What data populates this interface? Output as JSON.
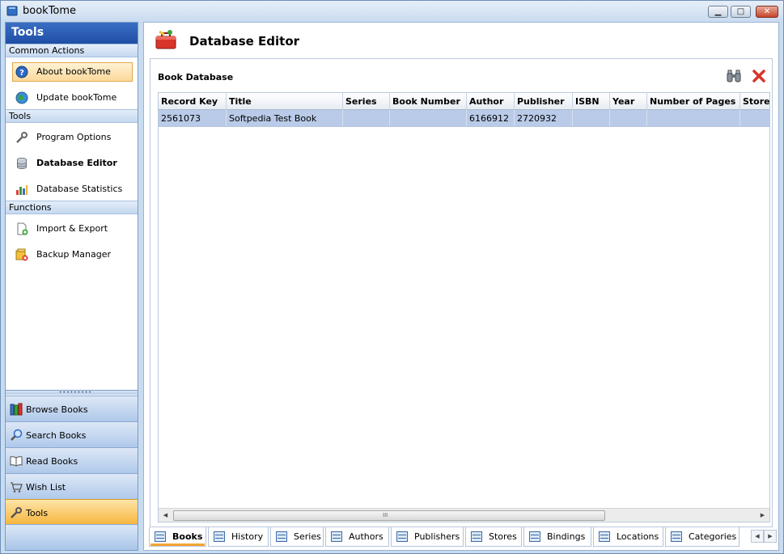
{
  "window": {
    "title": "bookTome",
    "controls": {
      "minimize": "▁",
      "maximize": "□",
      "close": "✕"
    }
  },
  "sidebar": {
    "header": "Tools",
    "groups": [
      {
        "label": "Common Actions",
        "items": [
          {
            "label": "About bookTome",
            "icon": "help-icon",
            "selected": true
          },
          {
            "label": "Update bookTome",
            "icon": "globe-icon"
          }
        ]
      },
      {
        "label": "Tools",
        "items": [
          {
            "label": "Program Options",
            "icon": "wrench-icon"
          },
          {
            "label": "Database Editor",
            "icon": "database-icon",
            "bold": true
          },
          {
            "label": "Database Statistics",
            "icon": "bar-chart-icon"
          }
        ]
      },
      {
        "label": "Functions",
        "items": [
          {
            "label": "Import & Export",
            "icon": "document-add-icon"
          },
          {
            "label": "Backup Manager",
            "icon": "backup-icon"
          }
        ]
      }
    ],
    "grip": "•••••••••",
    "nav": [
      {
        "label": "Browse Books",
        "icon": "books-icon"
      },
      {
        "label": "Search Books",
        "icon": "magnifier-icon"
      },
      {
        "label": "Read Books",
        "icon": "open-book-icon"
      },
      {
        "label": "Wish List",
        "icon": "cart-icon"
      },
      {
        "label": "Tools",
        "icon": "wrench-icon",
        "active": true
      }
    ]
  },
  "main": {
    "title": "Database Editor",
    "section_label": "Book Database",
    "toolbar": {
      "find_icon": "binoculars-icon",
      "delete_icon": "red-x-icon"
    },
    "columns": [
      "Record Key",
      "Title",
      "Series",
      "Book Number",
      "Author",
      "Publisher",
      "ISBN",
      "Year",
      "Number of Pages",
      "Store"
    ],
    "rows": [
      [
        "2561073",
        "Softpedia Test Book",
        "",
        "",
        "6166912",
        "2720932",
        "",
        "",
        "",
        ""
      ]
    ],
    "scroll": {
      "left": "◀",
      "right": "▶",
      "grip": "III"
    },
    "tabs": [
      {
        "label": "Books",
        "active": true
      },
      {
        "label": "History"
      },
      {
        "label": "Series"
      },
      {
        "label": "Authors"
      },
      {
        "label": "Publishers"
      },
      {
        "label": "Stores"
      },
      {
        "label": "Bindings"
      },
      {
        "label": "Locations"
      },
      {
        "label": "Categories"
      }
    ],
    "tab_nav": {
      "prev": "◀",
      "next": "▶"
    }
  },
  "colors": {
    "accent_orange": "#f6b53c",
    "header_blue": "#1f4ea5",
    "selection": "#b9cbe8"
  }
}
